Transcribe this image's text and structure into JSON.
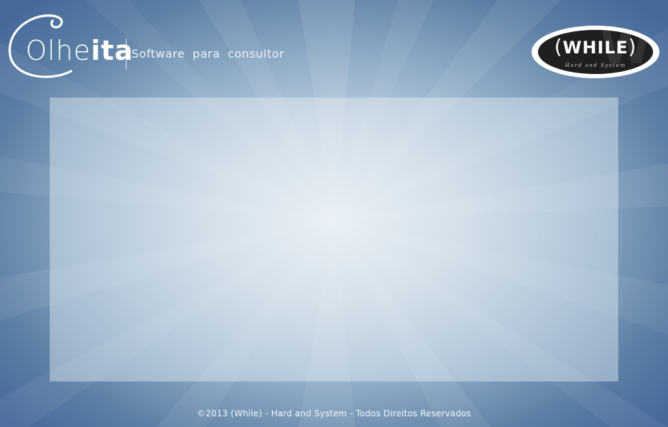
{
  "branding": {
    "app_logo": {
      "word_light": "Olhe",
      "word_bold": "ita",
      "tagline": "Software para consultor"
    },
    "company_logo": {
      "open_paren": "(",
      "name": "WHILE",
      "close_paren": ")",
      "subtitle": "Hard and System",
      "watermark": "W"
    }
  },
  "footer": {
    "copyright": "©2013 (While) - Hard and System - Todos Direitos  Reservados"
  },
  "colors": {
    "background_center": "#e9eff4",
    "background_edge": "#46699a",
    "text_light": "#ffffff",
    "company_logo_bg": "#1f1f1f"
  }
}
